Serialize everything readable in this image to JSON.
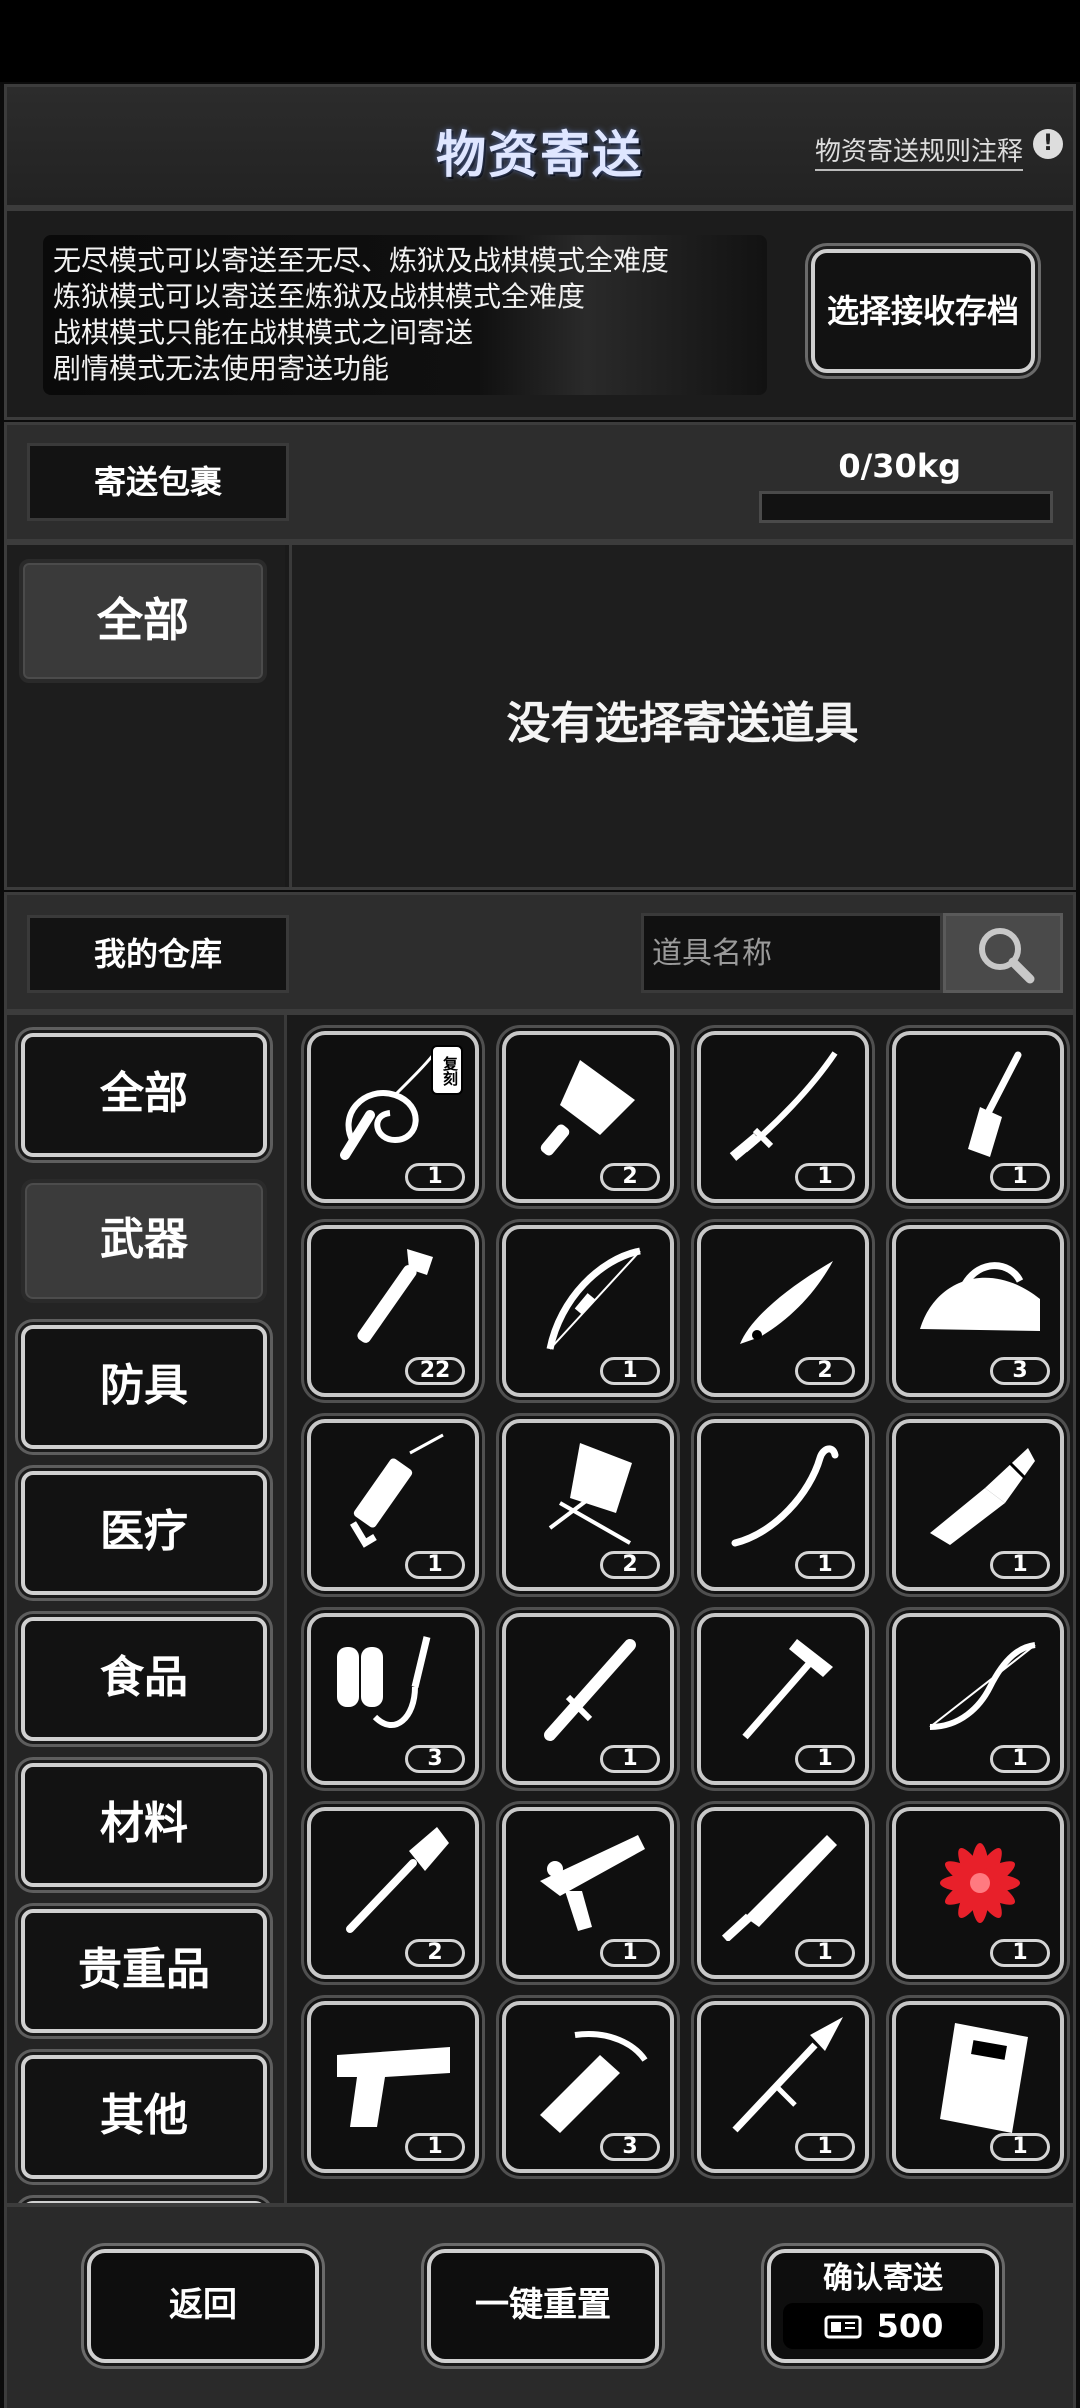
{
  "header": {
    "title": "物资寄送",
    "rules_link": "物资寄送规则注释"
  },
  "notice": {
    "lines": [
      "无尽模式可以寄送至无尽、炼狱及战棋模式全难度",
      "炼狱模式可以寄送至炼狱及战棋模式全难度",
      "战棋模式只能在战棋模式之间寄送",
      "剧情模式无法使用寄送功能"
    ],
    "select_save_label": "选择接收存档"
  },
  "parcel": {
    "label": "寄送包裹",
    "weight_text": "0/30kg",
    "weight_fraction": 0,
    "tab_all": "全部",
    "empty_message": "没有选择寄送道具"
  },
  "warehouse": {
    "label": "我的仓库",
    "search_placeholder": "道具名称",
    "categories": [
      "全部",
      "武器",
      "防具",
      "医疗",
      "食品",
      "材料",
      "贵重品",
      "其他"
    ],
    "active_category": "武器",
    "items": [
      {
        "icon": "whip-icon",
        "count": "1",
        "tag": "复刻"
      },
      {
        "icon": "cleaver-icon",
        "count": "2"
      },
      {
        "icon": "katana-icon",
        "count": "1"
      },
      {
        "icon": "spatula-icon",
        "count": "1"
      },
      {
        "icon": "pipe-wrench-icon",
        "count": "22"
      },
      {
        "icon": "bow-icon",
        "count": "1"
      },
      {
        "icon": "folding-knife-icon",
        "count": "2"
      },
      {
        "icon": "iron-icon",
        "count": "3"
      },
      {
        "icon": "caulk-gun-icon",
        "count": "1"
      },
      {
        "icon": "folding-chair-icon",
        "count": "2"
      },
      {
        "icon": "crowbar-icon",
        "count": "1"
      },
      {
        "icon": "combat-knife-icon",
        "count": "1"
      },
      {
        "icon": "flamethrower-icon",
        "count": "3"
      },
      {
        "icon": "baton-icon",
        "count": "1"
      },
      {
        "icon": "hammer-icon",
        "count": "1"
      },
      {
        "icon": "recurve-bow-icon",
        "count": "1"
      },
      {
        "icon": "shovel-icon",
        "count": "2"
      },
      {
        "icon": "nail-gun-icon",
        "count": "1"
      },
      {
        "icon": "machete-icon",
        "count": "1"
      },
      {
        "icon": "red-flower-icon",
        "count": "1"
      },
      {
        "icon": "pistol-icon",
        "count": "1"
      },
      {
        "icon": "crossbow-icon",
        "count": "3"
      },
      {
        "icon": "spear-icon",
        "count": "1"
      },
      {
        "icon": "riot-shield-icon",
        "count": "1"
      }
    ]
  },
  "footer": {
    "back_label": "返回",
    "reset_label": "一键重置",
    "confirm_label": "确认寄送",
    "confirm_cost": "500",
    "cost_icon": "ticket-icon"
  }
}
